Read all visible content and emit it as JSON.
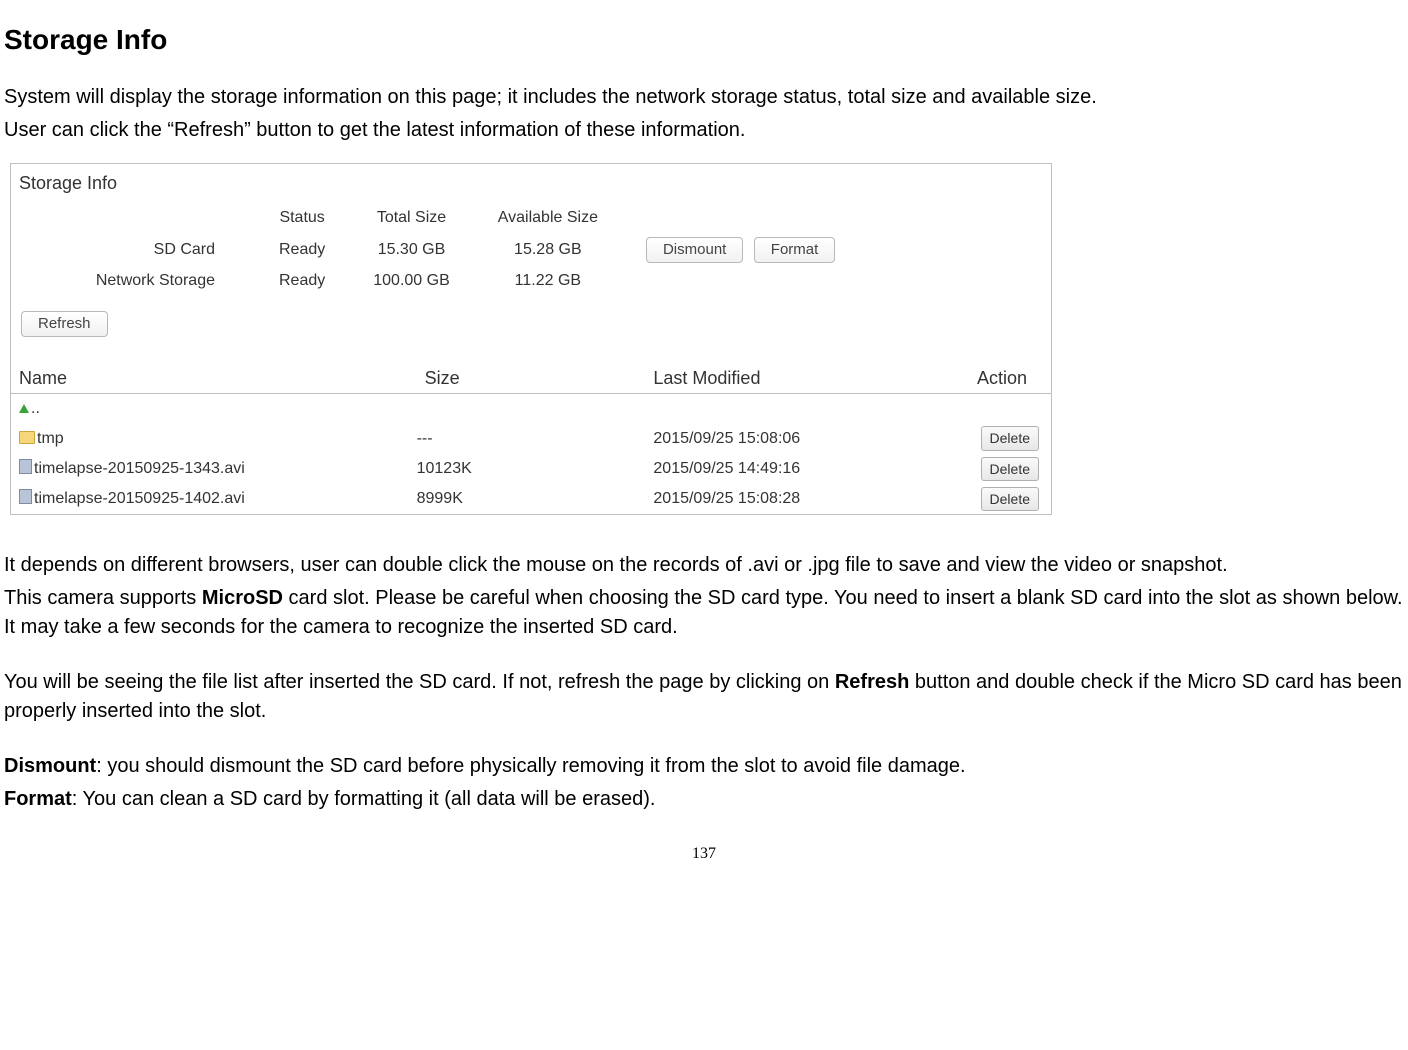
{
  "title": "Storage Info",
  "intro1": "System will display the storage information on this page; it includes the network storage status, total size and available size.",
  "intro2": "User can click the “Refresh” button to get the latest information of these information.",
  "panel": {
    "title": "Storage Info",
    "headers": {
      "c1": "Status",
      "c2": "Total Size",
      "c3": "Available Size"
    },
    "rows": [
      {
        "label": "SD Card",
        "status": "Ready",
        "total": "15.30 GB",
        "avail": "15.28 GB",
        "dismount": "Dismount",
        "format": "Format"
      },
      {
        "label": "Network Storage",
        "status": "Ready",
        "total": "100.00 GB",
        "avail": "11.22 GB",
        "dismount": "",
        "format": ""
      }
    ],
    "refresh": "Refresh",
    "file_headers": {
      "name": "Name",
      "size": "Size",
      "modified": "Last Modified",
      "action": "Action"
    },
    "files": [
      {
        "icon": "up",
        "name": "..",
        "size": "",
        "modified": "",
        "action": ""
      },
      {
        "icon": "folder",
        "name": "tmp",
        "size": "---",
        "modified": "2015/09/25 15:08:06",
        "action": "Delete"
      },
      {
        "icon": "file",
        "name": "timelapse-20150925-1343.avi",
        "size": "10123K",
        "modified": "2015/09/25 14:49:16",
        "action": "Delete"
      },
      {
        "icon": "file",
        "name": "timelapse-20150925-1402.avi",
        "size": "8999K",
        "modified": "2015/09/25 15:08:28",
        "action": "Delete"
      }
    ]
  },
  "p_afterpanel": "It depends on different browsers, user can double click the mouse on the records of .avi or .jpg file to save and view the video or snapshot.",
  "p_sd_a": "This camera supports ",
  "p_sd_bold": "MicroSD",
  "p_sd_b": " card slot. Please be careful when choosing the SD card type. You need to insert a blank SD card into the slot as shown below. It may take a few seconds for the camera to recognize the inserted SD card.",
  "p_list_a": "You will be seeing the file list after inserted the SD card. If not, refresh the page by clicking on ",
  "p_list_bold": "Refresh",
  "p_list_b": " button and double check if the Micro SD card has been properly inserted into the slot.",
  "p_dismount_bold": "Dismount",
  "p_dismount_txt": ": you should dismount the SD card before physically removing it from the slot to avoid file damage.",
  "p_format_bold": "Format",
  "p_format_txt": ": You can clean a SD card by formatting it (all data will be erased).",
  "page_number": "137"
}
